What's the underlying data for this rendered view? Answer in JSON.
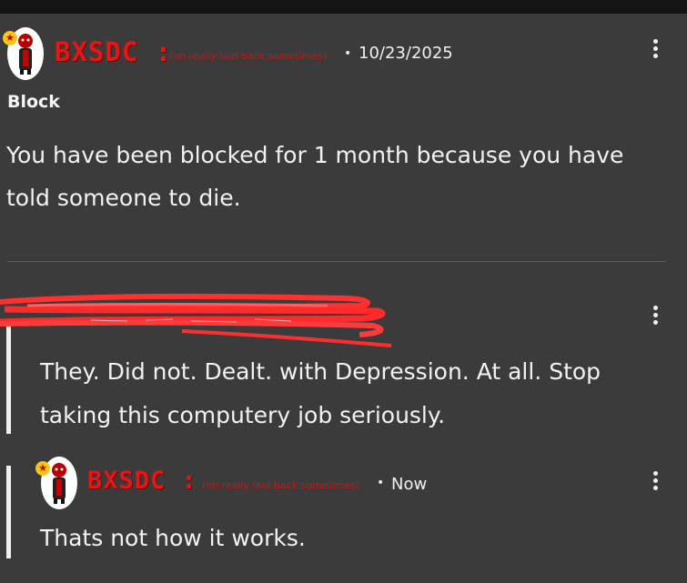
{
  "post": {
    "username": "BXSDC :",
    "tagline": "(im really laid back sometimes)",
    "separator": "•",
    "timestamp": "10/23/2025",
    "heading": "Block",
    "body_line1": "You have been blocked for 1 month because you have",
    "body_line2": "told someone to die."
  },
  "reply1": {
    "body_line1": "They. Did not. Dealt. with Depression. At all. Stop",
    "body_line2": "taking this computery job seriously."
  },
  "reply2": {
    "username": "BXSDC :",
    "tagline": "(im really laid back sometimes)",
    "separator": "•",
    "timestamp": "Now",
    "body": "Thats not how it works."
  },
  "colors": {
    "background": "#3b3b3c",
    "username_red": "#e41616",
    "text": "#f0f0f0"
  },
  "icons": {
    "menu": "kebab-menu-icon",
    "badge": "star-badge-icon"
  }
}
